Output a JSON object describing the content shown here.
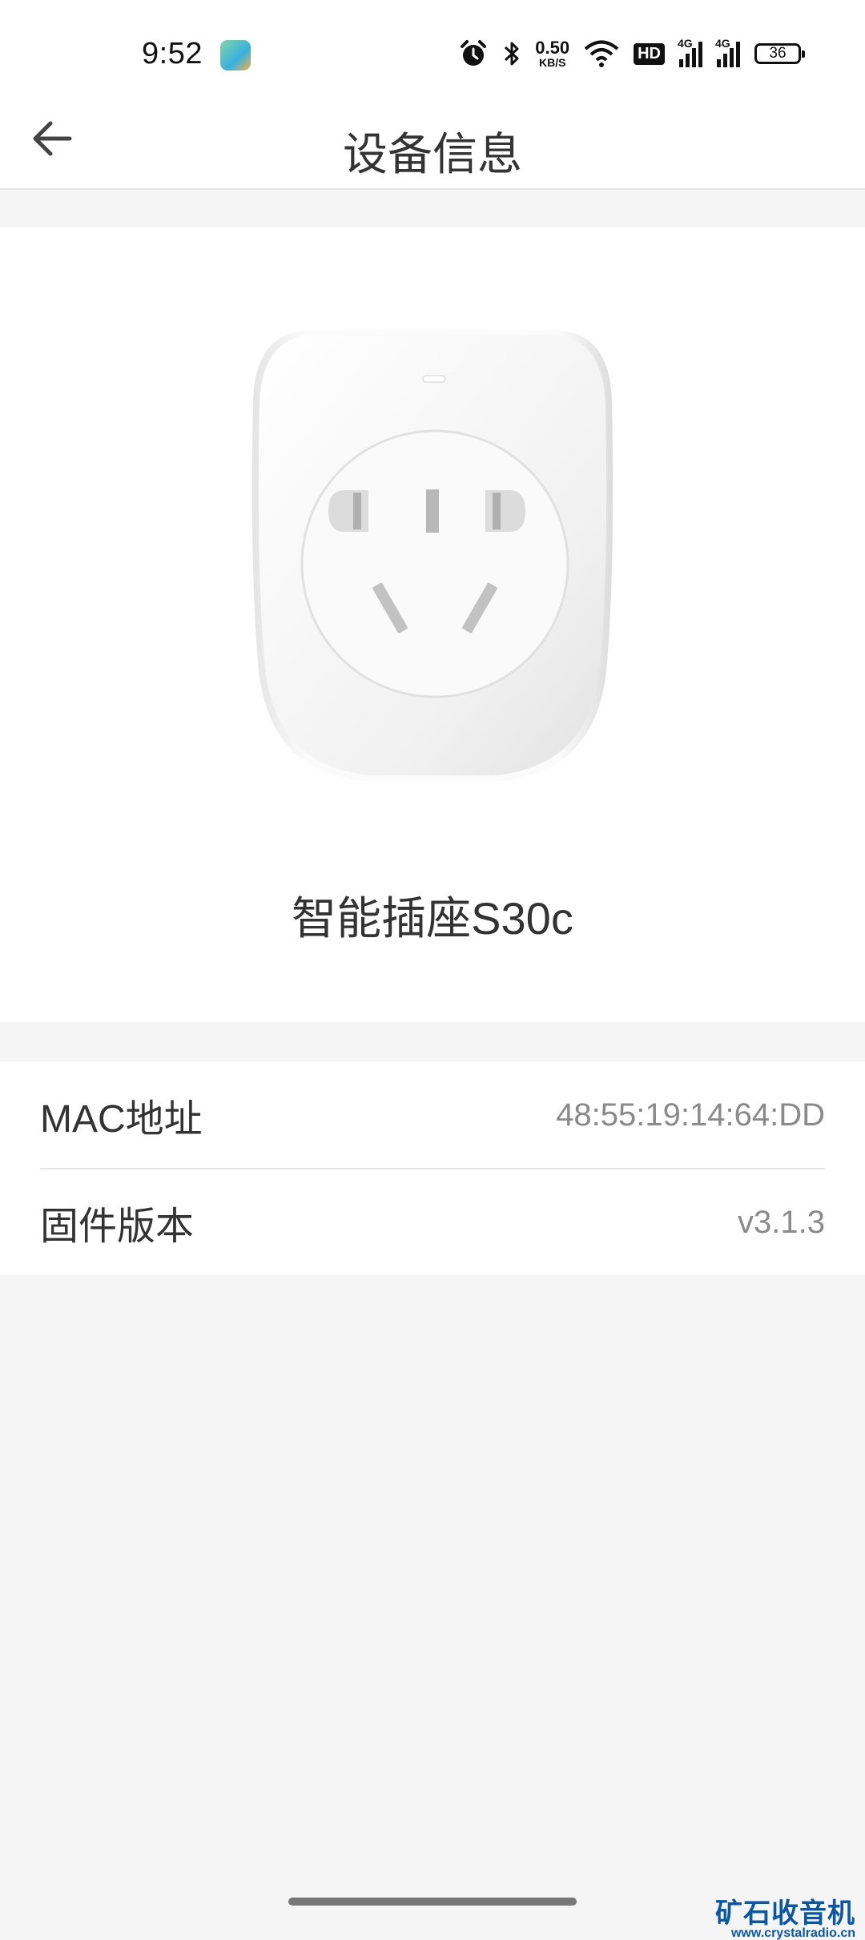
{
  "status_bar": {
    "time": "9:52",
    "net_speed_value": "0.50",
    "net_speed_unit": "KB/S",
    "hd_label": "HD",
    "signal_1_label": "4G",
    "signal_2_label": "4G",
    "battery": "36",
    "icons": [
      "alarm-icon",
      "bluetooth-icon",
      "wifi-icon"
    ]
  },
  "header": {
    "title": "设备信息",
    "back_icon": "arrow-left-icon"
  },
  "device": {
    "name": "智能插座S30c",
    "image": "smart-plug-image"
  },
  "info": {
    "rows": [
      {
        "label": "MAC地址",
        "value": "48:55:19:14:64:DD"
      },
      {
        "label": "固件版本",
        "value": "v3.1.3"
      }
    ]
  },
  "watermark": {
    "cn": "矿石收音机",
    "en": "www.crystalradio.cn"
  },
  "colors": {
    "background": "#f5f5f5",
    "card": "#ffffff",
    "text_primary": "#333333",
    "text_secondary": "#8a8a8a",
    "watermark": "#0a57a8"
  }
}
